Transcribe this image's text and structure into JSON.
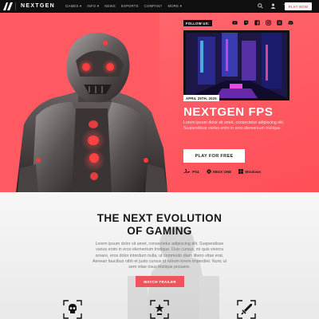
{
  "nav": {
    "logo": "AV",
    "brand": "NEXTGEN",
    "menu": [
      "GAMES ▾",
      "INFO ▾",
      "NEWS",
      "ESPORTS",
      "COMPANY",
      "MORE ▾"
    ],
    "icons": [
      "search-icon",
      "user-icon",
      "cart-icon"
    ],
    "cta": "PLAY NOW"
  },
  "hero": {
    "follow_label": "FOLLOW US:",
    "socials": [
      "youtube-icon",
      "twitch-icon",
      "facebook-icon",
      "instagram-icon",
      "twitter-icon",
      "discord-icon"
    ],
    "date": "APRIL 25TH, 2025",
    "title": "NEXTGEN FPS",
    "description": "Lorem ipsum dolor sit amet, consectetur adipiscing elit. Suspendisse varius enim in eros elementum tristique.",
    "cta": "PLAY FOR FREE",
    "platforms": [
      "PS4",
      "XBOX ONE",
      "Windows"
    ]
  },
  "section": {
    "title_line1": "THE NEXT EVOLUTION",
    "title_line2": "OF GAMING",
    "description": "Lorem ipsum dolor sit amet, consectetur adipiscing elit. Suspendisse varius enim in eros elementum tristique. Duis cursus, mi quis viverra ornare, eros dolor interdum nulla, ut commodo diam libero vitae erat. Aenean faucibus nibh et justo cursus id rutrum lorem imperdiet. Nunc ut sem vitae risus tristique posuere.",
    "cta": "WATCH TRAILER",
    "features": [
      "skull-icon",
      "trophy-icon",
      "sword-icon"
    ]
  },
  "colors": {
    "accent": "#f0545a",
    "nav_bg": "#101010",
    "hero_bg": "#ff5a62"
  }
}
